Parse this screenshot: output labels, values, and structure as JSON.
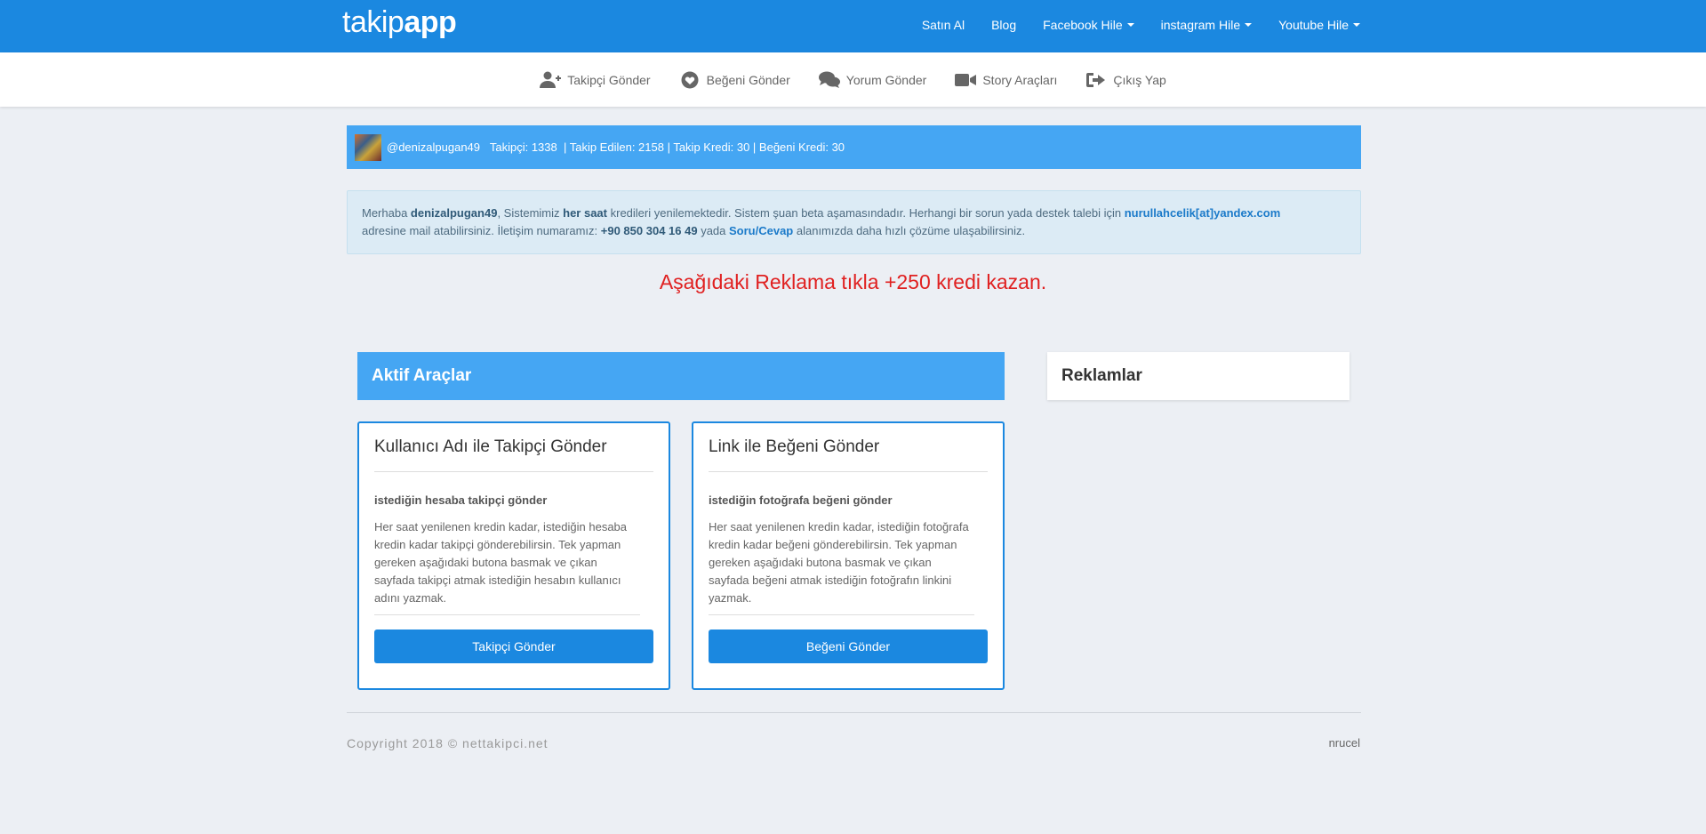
{
  "brand": {
    "light": "takip",
    "bold": "app"
  },
  "topmenu": [
    {
      "label": "Satın Al",
      "dropdown": false
    },
    {
      "label": "Blog",
      "dropdown": false
    },
    {
      "label": "Facebook Hile",
      "dropdown": true
    },
    {
      "label": "instagram Hile",
      "dropdown": true
    },
    {
      "label": "Youtube Hile",
      "dropdown": true
    }
  ],
  "subnav": [
    {
      "label": "Takipçi Gönder",
      "icon": "user-plus-icon"
    },
    {
      "label": "Beğeni Gönder",
      "icon": "heart-icon"
    },
    {
      "label": "Yorum Gönder",
      "icon": "comments-icon"
    },
    {
      "label": "Story Araçları",
      "icon": "video-camera-icon"
    },
    {
      "label": "Çıkış Yap",
      "icon": "sign-out-icon"
    }
  ],
  "userbar": {
    "username": "@denizalpugan49",
    "stats": "Takipçi: 1338  | Takip Edilen: 2158 | Takip Kredi: 30 | Beğeni Kredi: 30"
  },
  "alert": {
    "greeting": "Merhaba ",
    "name": "denizalpugan49",
    "part1": ", Sistemimiz ",
    "hersaat": "her saat",
    "part2": " kredileri yenilemektedir. Sistem şuan beta aşamasındadır. Herhangi bir sorun yada destek talebi için ",
    "email": "nurullahcelik[at]yandex.com",
    "part3": "adresine mail atabilirsiniz. İletişim numaramız: ",
    "phone": "+90 850 304 16 49",
    "part4": " yada ",
    "link": "Soru/Cevap",
    "part5": " alanımızda daha hızlı çözüme ulaşabilirsiniz."
  },
  "promo": "Aşağıdaki Reklama tıkla +250 kredi kazan.",
  "panel_title": "Aktif Araçlar",
  "ads_title": "Reklamlar",
  "cards": [
    {
      "title": "Kullanıcı Adı ile Takipçi Gönder",
      "subtitle": "istediğin hesaba takipçi gönder",
      "text": "Her saat yenilenen kredin kadar, istediğin hesaba kredin kadar takipçi gönderebilirsin. Tek yapman gereken aşağıdaki butona basmak ve çıkan sayfada takipçi atmak istediğin hesabın kullanıcı adını yazmak.",
      "button": "Takipçi Gönder"
    },
    {
      "title": "Link ile Beğeni Gönder",
      "subtitle": "istediğin fotoğrafa beğeni gönder",
      "text": "Her saat yenilenen kredin kadar, istediğin fotoğrafa kredin kadar beğeni gönderebilirsin. Tek yapman gereken aşağıdaki butona basmak ve çıkan sayfada beğeni atmak istediğin fotoğrafın linkini yazmak.",
      "button": "Beğeni Gönder"
    }
  ],
  "footer": {
    "copyright": "Copyright 2018 © nettakipci.net",
    "right": "nrucel"
  },
  "colors": {
    "primary": "#1b88e0",
    "light_blue": "#45a6f3",
    "promo_red": "#e02020",
    "background": "#eceff4"
  }
}
